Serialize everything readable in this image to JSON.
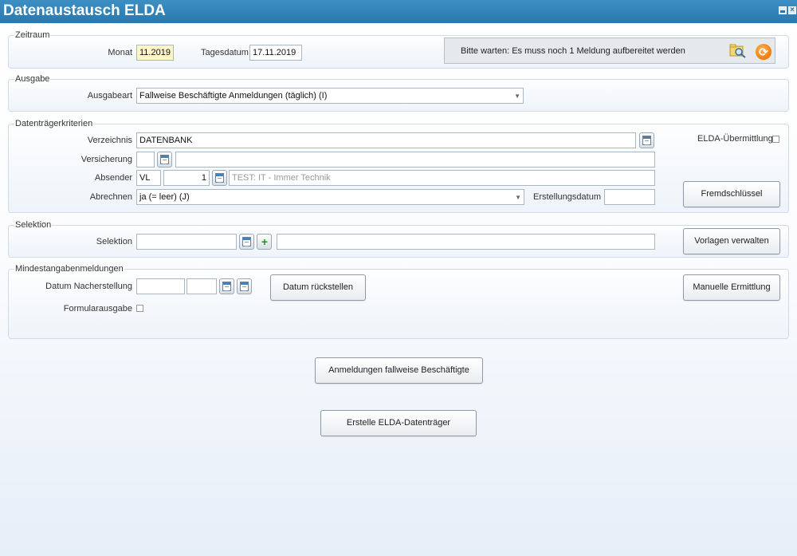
{
  "window": {
    "title": "Datenaustausch ELDA"
  },
  "zeitraum": {
    "legend": "Zeitraum",
    "monat_label": "Monat",
    "monat_value": "11.2019",
    "tagesdatum_label": "Tagesdatum",
    "tagesdatum_value": "17.11.2019",
    "message": "Bitte warten: Es muss noch 1 Meldung aufbereitet werden"
  },
  "ausgabe": {
    "legend": "Ausgabe",
    "ausgabeart_label": "Ausgabeart",
    "ausgabeart_value": "Fallweise Beschäftigte Anmeldungen (täglich) (I)"
  },
  "datentraeger": {
    "legend": "Datenträgerkriterien",
    "verzeichnis_label": "Verzeichnis",
    "verzeichnis_value": "DATENBANK",
    "versicherung_label": "Versicherung",
    "versicherung_value": "",
    "versicherung_name": "",
    "absender_label": "Absender",
    "absender_code": "VL",
    "absender_nr": "1",
    "absender_name": "TEST: IT - Immer Technik",
    "abrechnen_label": "Abrechnen",
    "abrechnen_value": "ja (= leer) (J)",
    "erstellungsdatum_label": "Erstellungsdatum",
    "erstellungsdatum_value": "",
    "elda_label": "ELDA-Übermittlung",
    "fremdschluessel_button": "Fremdschlüssel"
  },
  "selektion": {
    "legend": "Selektion",
    "selektion_label": "Selektion",
    "selektion_value": "",
    "selektion_text": "",
    "vorlagen_button": "Vorlagen verwalten"
  },
  "mindest": {
    "legend": "Mindestangabenmeldungen",
    "datum_label": "Datum Nacherstellung",
    "formular_label": "Formularausgabe",
    "datum_zurueck_button": "Datum rückstellen",
    "manuelle_button": "Manuelle Ermittlung"
  },
  "actions": {
    "anmeldungen_button": "Anmeldungen fallweise Beschäftigte",
    "erstelle_button": "Erstelle ELDA-Datenträger"
  }
}
